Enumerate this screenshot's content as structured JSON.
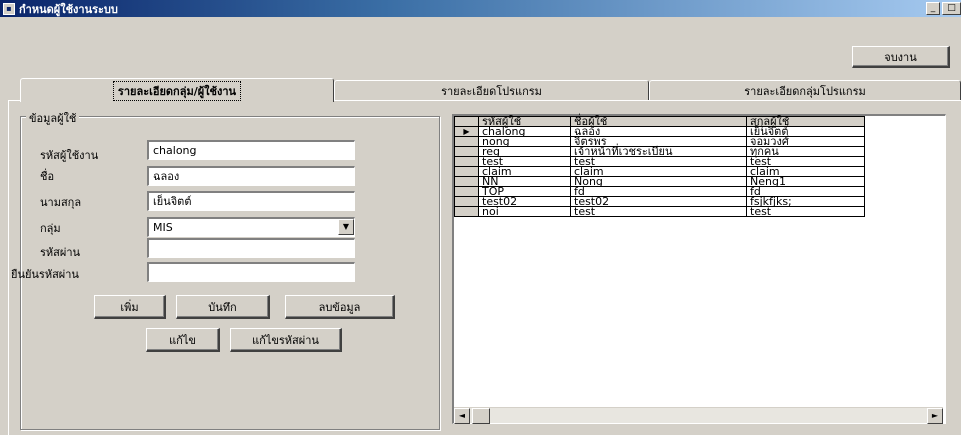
{
  "window": {
    "title": "กำหนดผู้ใช้งานระบบ",
    "minimize_glyph": "_",
    "close_glyph": "□"
  },
  "toolbar": {
    "exit_label": "จบงาน"
  },
  "tabs": [
    {
      "label": "รายละเอียดกลุ่ม/ผู้ใช้งาน",
      "active": true
    },
    {
      "label": "รายละเอียดโปรแกรม",
      "active": false
    },
    {
      "label": "รายละเอียดกลุ่มโปรแกรม",
      "active": false
    }
  ],
  "form": {
    "group_title": "ข้อมูลผู้ใช้",
    "username_label": "รหัสผู้ใช้งาน",
    "username_value": "chalong",
    "firstname_label": "ชื่อ",
    "firstname_value": "ฉลอง",
    "lastname_label": "นามสกุล",
    "lastname_value": "เย็นจิตต์",
    "group_label": "กลุ่ม",
    "group_value": "MIS",
    "password_label": "รหัสผ่าน",
    "password_value": "",
    "confirm_label": "ยืนยันรหัสผ่าน",
    "confirm_value": "",
    "add_label": "เพิ่ม",
    "save_label": "บันทึก",
    "delete_label": "ลบข้อมูล",
    "edit_label": "แก้ไข",
    "edit_password_label": "แก้ไขรหัสผ่าน"
  },
  "grid": {
    "columns": [
      "รหัสผู้ใช้",
      "ชื่อผู้ใช้",
      "สกุลผู้ใช้"
    ],
    "selected_marker": "▶",
    "rows": [
      [
        "chalong",
        "ฉลอง",
        "เย็นจิตต์"
      ],
      [
        "nong",
        "จิตรพร",
        "จอมวงศ์"
      ],
      [
        "reg",
        "เจ้าหน้าที่เวชระเบียน",
        "ทุกคน"
      ],
      [
        "test",
        "test",
        " test"
      ],
      [
        "claim",
        "claim",
        "claim"
      ],
      [
        "NN",
        "Nong",
        "Neng1"
      ],
      [
        "TOP",
        "fd",
        "fd"
      ],
      [
        "test02",
        "test02",
        "fsjkfjks;"
      ],
      [
        "noi",
        "test",
        "test"
      ]
    ],
    "scroll_left": "◄",
    "scroll_right": "►"
  }
}
